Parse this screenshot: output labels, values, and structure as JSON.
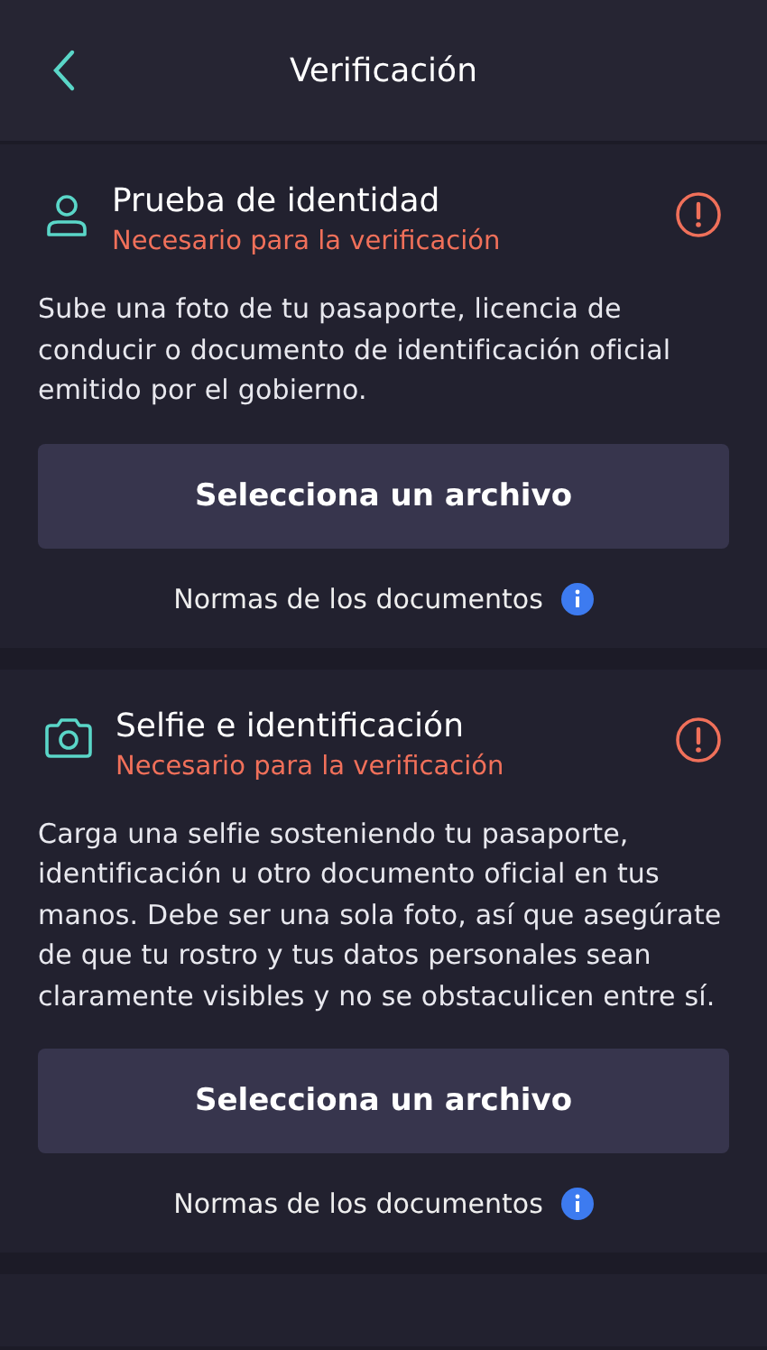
{
  "header": {
    "title": "Verificación"
  },
  "sections": [
    {
      "kind": "person",
      "title": "Prueba de identidad",
      "status": "Necesario para la verificación",
      "warning": true,
      "description": "Sube una foto de tu pasaporte, licencia de conducir o documento de identificación oficial emitido por el gobierno.",
      "button": "Selecciona un archivo",
      "link": "Normas de los documentos"
    },
    {
      "kind": "camera",
      "title": "Selfie e identificación",
      "status": "Necesario para la verificación",
      "warning": true,
      "description": "Carga una selfie sosteniendo tu pasaporte, identificación u otro documento oficial en tus manos. Debe ser una sola foto, así que asegúrate de que tu rostro y tus datos personales sean claramente visibles y no se obstaculicen entre sí.",
      "button": "Selecciona un archivo",
      "link": "Normas de los documentos"
    }
  ]
}
